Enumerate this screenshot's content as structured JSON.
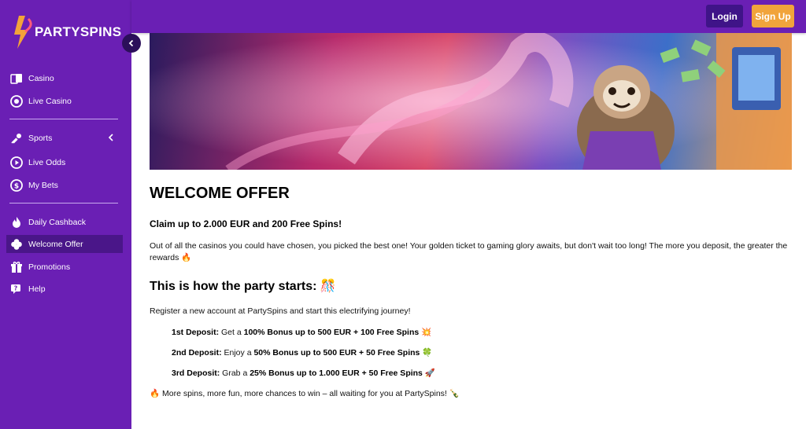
{
  "brand": {
    "name": "PARTYSPINS"
  },
  "header": {
    "login_label": "Login",
    "signup_label": "Sign Up"
  },
  "sidebar": {
    "items": [
      {
        "label": "Casino",
        "icon": "cards-icon"
      },
      {
        "label": "Live Casino",
        "icon": "chip-icon"
      },
      {
        "label": "Sports",
        "icon": "sports-icon"
      },
      {
        "label": "Live Odds",
        "icon": "play-icon"
      },
      {
        "label": "My Bets",
        "icon": "coin-icon"
      },
      {
        "label": "Daily Cashback",
        "icon": "flame-icon"
      },
      {
        "label": "Welcome Offer",
        "icon": "clover-icon",
        "active": true
      },
      {
        "label": "Promotions",
        "icon": "gift-icon"
      },
      {
        "label": "Help",
        "icon": "help-chat-icon"
      }
    ]
  },
  "main": {
    "title": "WELCOME OFFER",
    "claim": "Claim up to 2.000 EUR and 200 Free Spins!",
    "intro": "Out of all the casinos you could have chosen, you picked the best one! Your golden ticket to gaming glory awaits, but don't wait too long! The more you deposit, the greater the rewards 🔥",
    "subtitle": "This is how the party starts: 🎊",
    "register": "Register a new account at PartySpins and start this electrifying journey!",
    "deposits": [
      {
        "label": "1st Deposit:",
        "verb": " Get a ",
        "bonus": "100% Bonus up to 500 EUR + 100 Free Spins",
        "emoji": " 💥"
      },
      {
        "label": "2nd Deposit:",
        "verb": " Enjoy a ",
        "bonus": "50% Bonus up to 500 EUR + 50 Free Spins",
        "emoji": " 🍀"
      },
      {
        "label": "3rd Deposit:",
        "verb": " Grab a ",
        "bonus": "25% Bonus up to 1.000 EUR + 50 Free Spins",
        "emoji": " 🚀"
      }
    ],
    "closing": "🔥 More spins, more fun, more chances to win – all waiting for you at PartySpins! 🍾"
  },
  "colors": {
    "sidebar": "#6a1fb4",
    "active": "#4a1689",
    "login": "#3f1488",
    "signup": "#f1a43b",
    "logo_accent": "#f3a33a"
  }
}
